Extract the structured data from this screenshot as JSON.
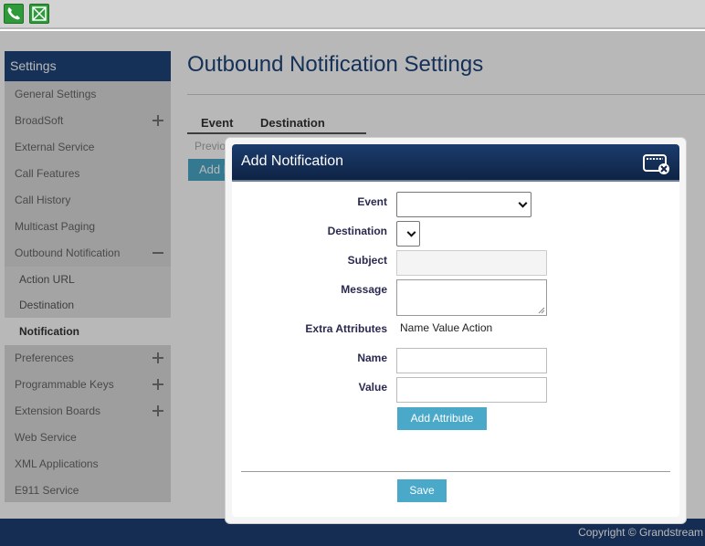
{
  "toolbar": {
    "icons": [
      "phone-icon",
      "contact-card-icon"
    ]
  },
  "sidebar": {
    "header": "Settings",
    "items": [
      {
        "label": "General Settings"
      },
      {
        "label": "BroadSoft",
        "expand": "plus"
      },
      {
        "label": "External Service"
      },
      {
        "label": "Call Features"
      },
      {
        "label": "Call History"
      },
      {
        "label": "Multicast Paging"
      },
      {
        "label": "Outbound Notification",
        "expand": "minus"
      }
    ],
    "subitems": [
      {
        "label": "Action URL"
      },
      {
        "label": "Destination"
      },
      {
        "label": "Notification",
        "active": true
      }
    ],
    "items_after": [
      {
        "label": "Preferences",
        "expand": "plus"
      },
      {
        "label": "Programmable Keys",
        "expand": "plus"
      },
      {
        "label": "Extension Boards",
        "expand": "plus"
      },
      {
        "label": "Web Service"
      },
      {
        "label": "XML Applications"
      },
      {
        "label": "E911 Service"
      }
    ]
  },
  "main": {
    "title": "Outbound Notification Settings",
    "columns": [
      "Event",
      "Destination"
    ],
    "row_preview": "Previo",
    "add_button": "Add N"
  },
  "dialog": {
    "title": "Add Notification",
    "fields": {
      "event_label": "Event",
      "event_value": "",
      "destination_label": "Destination",
      "destination_value": "",
      "subject_label": "Subject",
      "subject_value": "",
      "message_label": "Message",
      "message_value": "",
      "extra_label": "Extra Attributes",
      "extra_columns": "Name Value Action",
      "name_label": "Name",
      "name_value": "",
      "value_label": "Value",
      "value_value": ""
    },
    "add_attribute_button": "Add Attribute",
    "save_button": "Save"
  },
  "footer": {
    "copyright": "Copyright © Grandstream"
  },
  "colors": {
    "accent_navy": "#1e4479",
    "button_blue": "#4aa8c9",
    "toolbar_green": "#2f9a3a"
  }
}
